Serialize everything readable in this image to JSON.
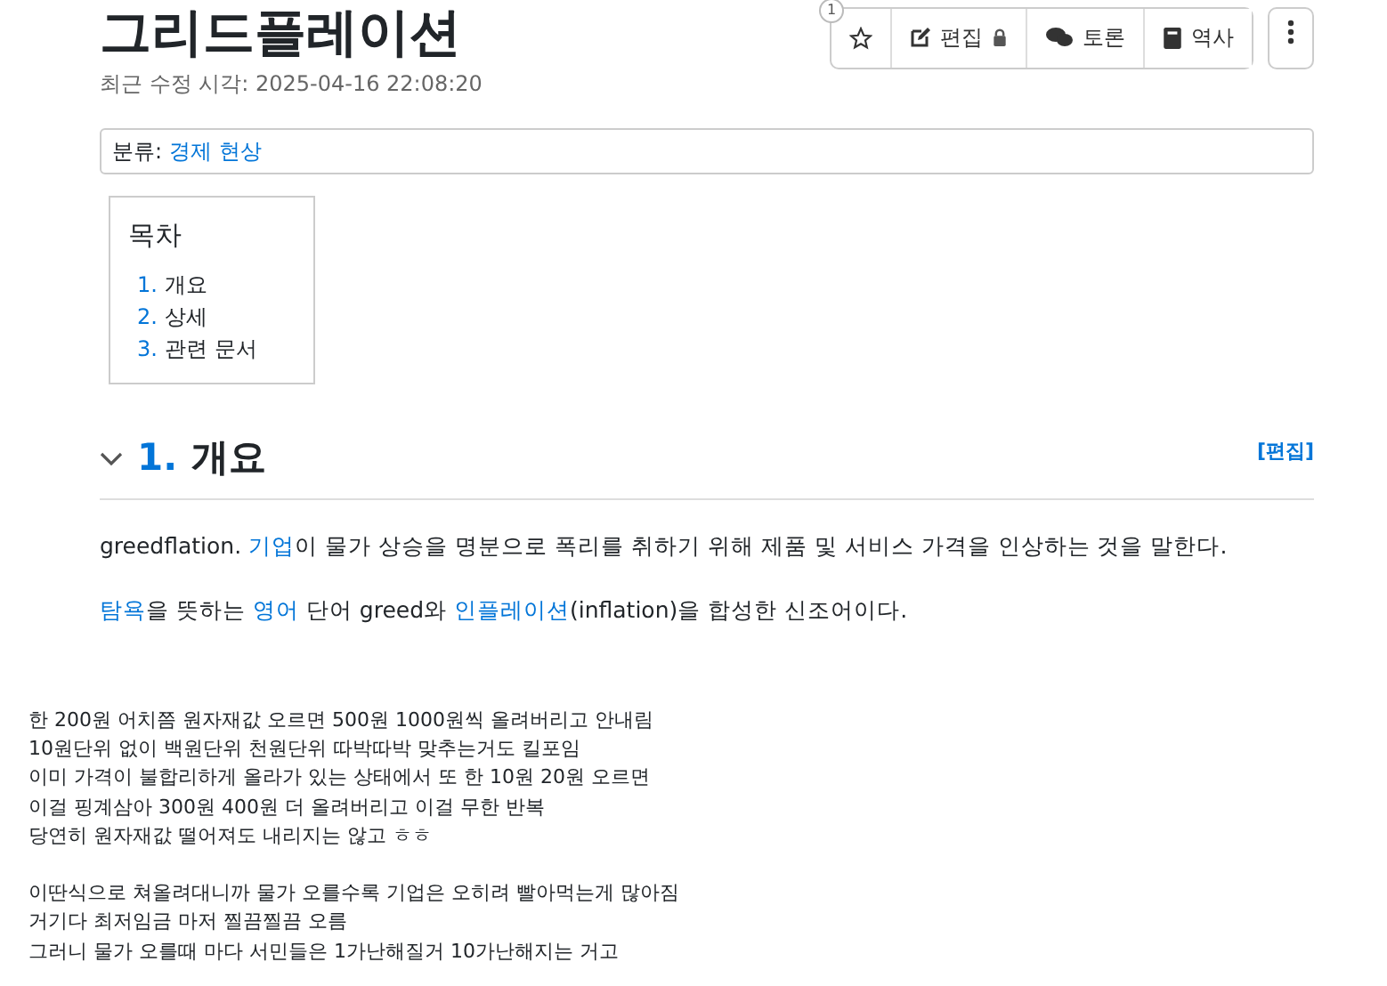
{
  "title": "그리드플레이션",
  "modified": "최근 수정 시각: 2025-04-16 22:08:20",
  "badge": "1",
  "buttons": [
    {
      "kind": "star"
    },
    {
      "kind": "edit",
      "label": "편집",
      "locked": true
    },
    {
      "kind": "discuss",
      "label": "토론"
    },
    {
      "kind": "history",
      "label": "역사"
    },
    {
      "kind": "more"
    }
  ],
  "category": {
    "label": "분류:",
    "link": "경제 현상"
  },
  "toc": {
    "title": "목차",
    "items": [
      {
        "number": "1.",
        "label": "개요"
      },
      {
        "number": "2.",
        "label": "상세"
      },
      {
        "number": "3.",
        "label": "관련 문서"
      }
    ]
  },
  "section": {
    "number": "1.",
    "title": "개요",
    "expanded": true,
    "edit": "[편집]"
  },
  "paragraphs": [
    [
      {
        "text": "greedflation. ",
        "link": false
      },
      {
        "text": "기업",
        "link": true
      },
      {
        "text": "이 물가 상승을 명분으로 폭리를 취하기 위해 제품 및 서비스 가격을 인상하는 것을 말한다.",
        "link": false
      }
    ],
    [
      {
        "text": "탐욕",
        "link": true
      },
      {
        "text": "을 뜻하는 ",
        "link": false
      },
      {
        "text": "영어",
        "link": true
      },
      {
        "text": " 단어 greed와 ",
        "link": false
      },
      {
        "text": "인플레이션",
        "link": true
      },
      {
        "text": "(inflation)을 합성한 신조어이다.",
        "link": false
      }
    ]
  ],
  "comment_blocks": [
    [
      "한 200원 어치쯤 원자재값 오르면 500원 1000원씩 올려버리고 안내림",
      "10원단위 없이 백원단위 천원단위 따박따박 맞추는거도 킬포임",
      "이미 가격이 불합리하게 올라가 있는 상태에서 또 한 10원 20원 오르면",
      "이걸 핑계삼아 300원 400원 더 올려버리고 이걸 무한 반복",
      "당연히 원자재값 떨어져도 내리지는 않고 ㅎㅎ"
    ],
    [
      "이딴식으로 쳐올려대니까 물가 오를수록 기업은 오히려 빨아먹는게 많아짐",
      "거기다 최저임금 마저 찔끔찔끔 오름",
      "그러니 물가 오를때 마다 서민들은 1가난해질거 10가난해지는 거고"
    ]
  ]
}
